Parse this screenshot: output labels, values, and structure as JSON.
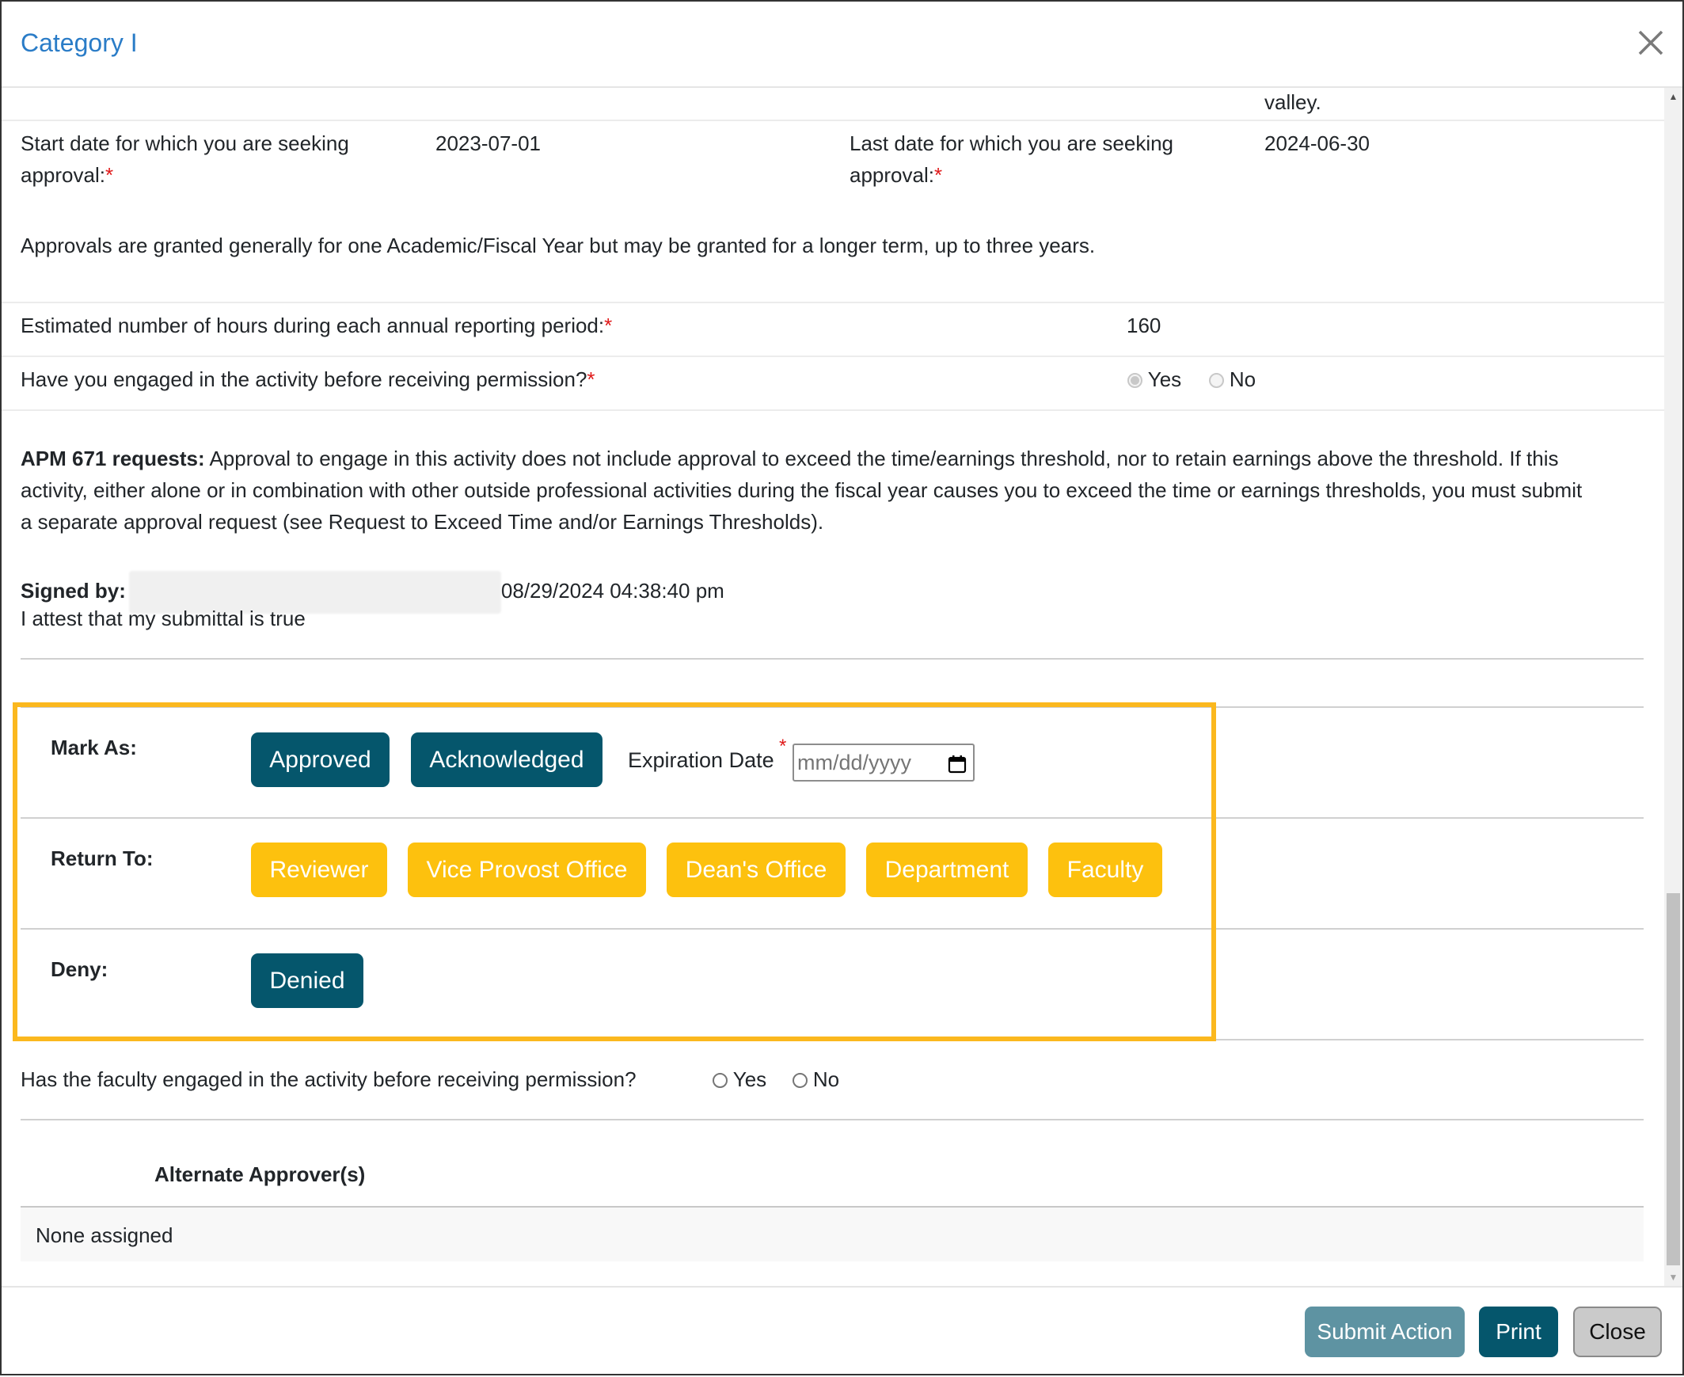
{
  "modal": {
    "title": "Category I",
    "close_icon": "close-icon"
  },
  "form": {
    "prev_value_tail": "valley.",
    "start_date_label": "Start date for which you are seeking",
    "start_date_label_2": "approval:",
    "start_date_value": "2023-07-01",
    "end_date_label": "Last date for which you are seeking",
    "end_date_label_2": "approval:",
    "end_date_value": "2024-06-30",
    "required_mark": "*",
    "approval_note": "Approvals are granted generally for one Academic/Fiscal Year but may be granted for a longer term, up to three years.",
    "hours_label": "Estimated number of hours during each annual reporting period:",
    "hours_value": "160",
    "engaged_label": "Have you engaged in the activity before receiving permission?",
    "engaged_options": [
      {
        "label": "Yes",
        "checked": true
      },
      {
        "label": "No",
        "checked": false
      }
    ],
    "apm_title": "APM 671 requests:",
    "apm_line1": " Approval to engage in this activity does not include approval to exceed the time/earnings threshold, nor to retain earnings above the threshold. If this",
    "apm_line2": "activity, either alone or in combination with other outside professional activities during the fiscal year causes you to exceed the time or earnings thresholds, you must submit",
    "apm_line3": "a separate approval request (see Request to Exceed Time and/or Earnings Thresholds).",
    "signed_label": "Signed by:",
    "signed_timestamp": "08/29/2024 04:38:40 pm",
    "attest_text": "I attest that my submittal is true"
  },
  "actions": {
    "mark_as_label": "Mark As:",
    "mark_as_buttons": [
      "Approved",
      "Acknowledged"
    ],
    "expiration_label": "Expiration Date",
    "expiration_required": "*",
    "expiration_placeholder": "mm/dd/yyyy",
    "return_to_label": "Return To:",
    "return_to_buttons": [
      "Reviewer",
      "Vice Provost Office",
      "Dean's Office",
      "Department",
      "Faculty"
    ],
    "deny_label": "Deny:",
    "deny_button": "Denied"
  },
  "faculty_engaged": {
    "label": "Has the faculty engaged in the activity before receiving permission?",
    "options": [
      {
        "label": "Yes",
        "checked": false
      },
      {
        "label": "No",
        "checked": false
      }
    ]
  },
  "alternate_approvers": {
    "header": "Alternate Approver(s)",
    "value": "None assigned"
  },
  "footer": {
    "submit_label": "Submit Action",
    "print_label": "Print",
    "close_label": "Close"
  },
  "colors": {
    "title_blue": "#2a7cc7",
    "dark_teal": "#05566c",
    "yellow": "#fdc10e",
    "highlight_border": "#fbb81e",
    "submit_disabled": "#5e93a2",
    "required_red": "#e01919"
  }
}
